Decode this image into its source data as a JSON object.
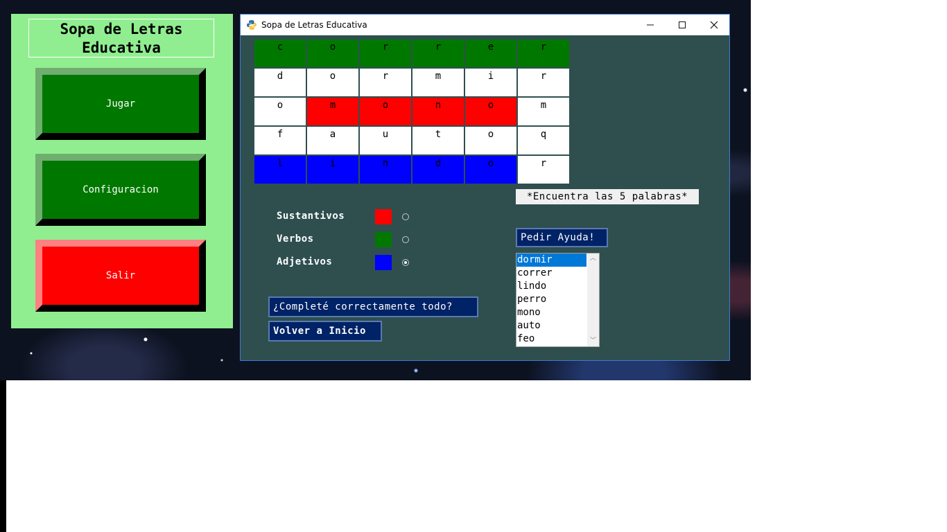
{
  "menu": {
    "title": "Sopa de Letras\nEducativa",
    "buttons": [
      "Jugar",
      "Configuracion",
      "Salir"
    ]
  },
  "window": {
    "title": "Sopa de Letras Educativa",
    "icon": "python-icon",
    "controls": [
      "minimize-icon",
      "maximize-icon",
      "close-icon"
    ]
  },
  "grid": {
    "rows": [
      [
        "c",
        "o",
        "r",
        "r",
        "e",
        "r"
      ],
      [
        "d",
        "o",
        "r",
        "m",
        "i",
        "r"
      ],
      [
        "o",
        "m",
        "o",
        "n",
        "o",
        "m"
      ],
      [
        "f",
        "a",
        "u",
        "t",
        "o",
        "q"
      ],
      [
        "l",
        "i",
        "n",
        "d",
        "o",
        "r"
      ]
    ],
    "colors": [
      [
        "#007800",
        "#007800",
        "#007800",
        "#007800",
        "#007800",
        "#007800"
      ],
      [
        "#ffffff",
        "#ffffff",
        "#ffffff",
        "#ffffff",
        "#ffffff",
        "#ffffff"
      ],
      [
        "#ffffff",
        "#ff0000",
        "#ff0000",
        "#ff0000",
        "#ff0000",
        "#ffffff"
      ],
      [
        "#ffffff",
        "#ffffff",
        "#ffffff",
        "#ffffff",
        "#ffffff",
        "#ffffff"
      ],
      [
        "#0000ff",
        "#0000ff",
        "#0000ff",
        "#0000ff",
        "#0000ff",
        "#ffffff"
      ]
    ]
  },
  "categories": [
    {
      "label": "Sustantivos",
      "color": "#ff0000",
      "selected": false
    },
    {
      "label": "Verbos",
      "color": "#007800",
      "selected": false
    },
    {
      "label": "Adjetivos",
      "color": "#0000ff",
      "selected": true
    }
  ],
  "hint": "*Encuentra las 5 palabras*",
  "help_button": "Pedir Ayuda!",
  "words": [
    "dormir",
    "correr",
    "lindo",
    "perro",
    "mono",
    "auto",
    "feo"
  ],
  "selected_word": "dormir",
  "check_button": "¿Completé correctamente todo?",
  "back_button": "Volver a Inicio"
}
